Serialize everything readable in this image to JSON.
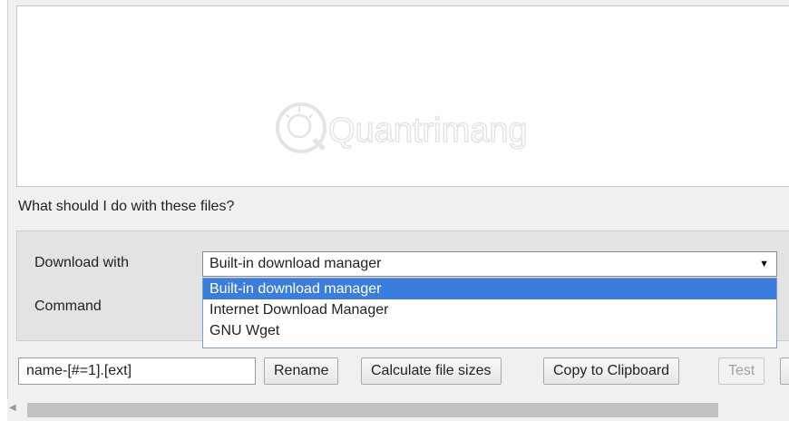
{
  "question": "What should I do with these files?",
  "download_with": {
    "label": "Download with",
    "selected": "Built-in download manager",
    "options": [
      "Built-in download manager",
      "Internet Download Manager",
      "GNU Wget"
    ]
  },
  "command": {
    "label": "Command"
  },
  "toolbar": {
    "name_pattern": "name-[#=1].[ext]",
    "rename_label": "Rename",
    "calc_label": "Calculate file sizes",
    "copy_label": "Copy to Clipboard",
    "test_label": "Test"
  },
  "watermark": {
    "text": "Quantrimang",
    "icon": "lightbulb-logo"
  },
  "icons": {
    "dropdown_arrow": "triangle-down-icon",
    "scroll_left": "triangle-left-icon"
  }
}
